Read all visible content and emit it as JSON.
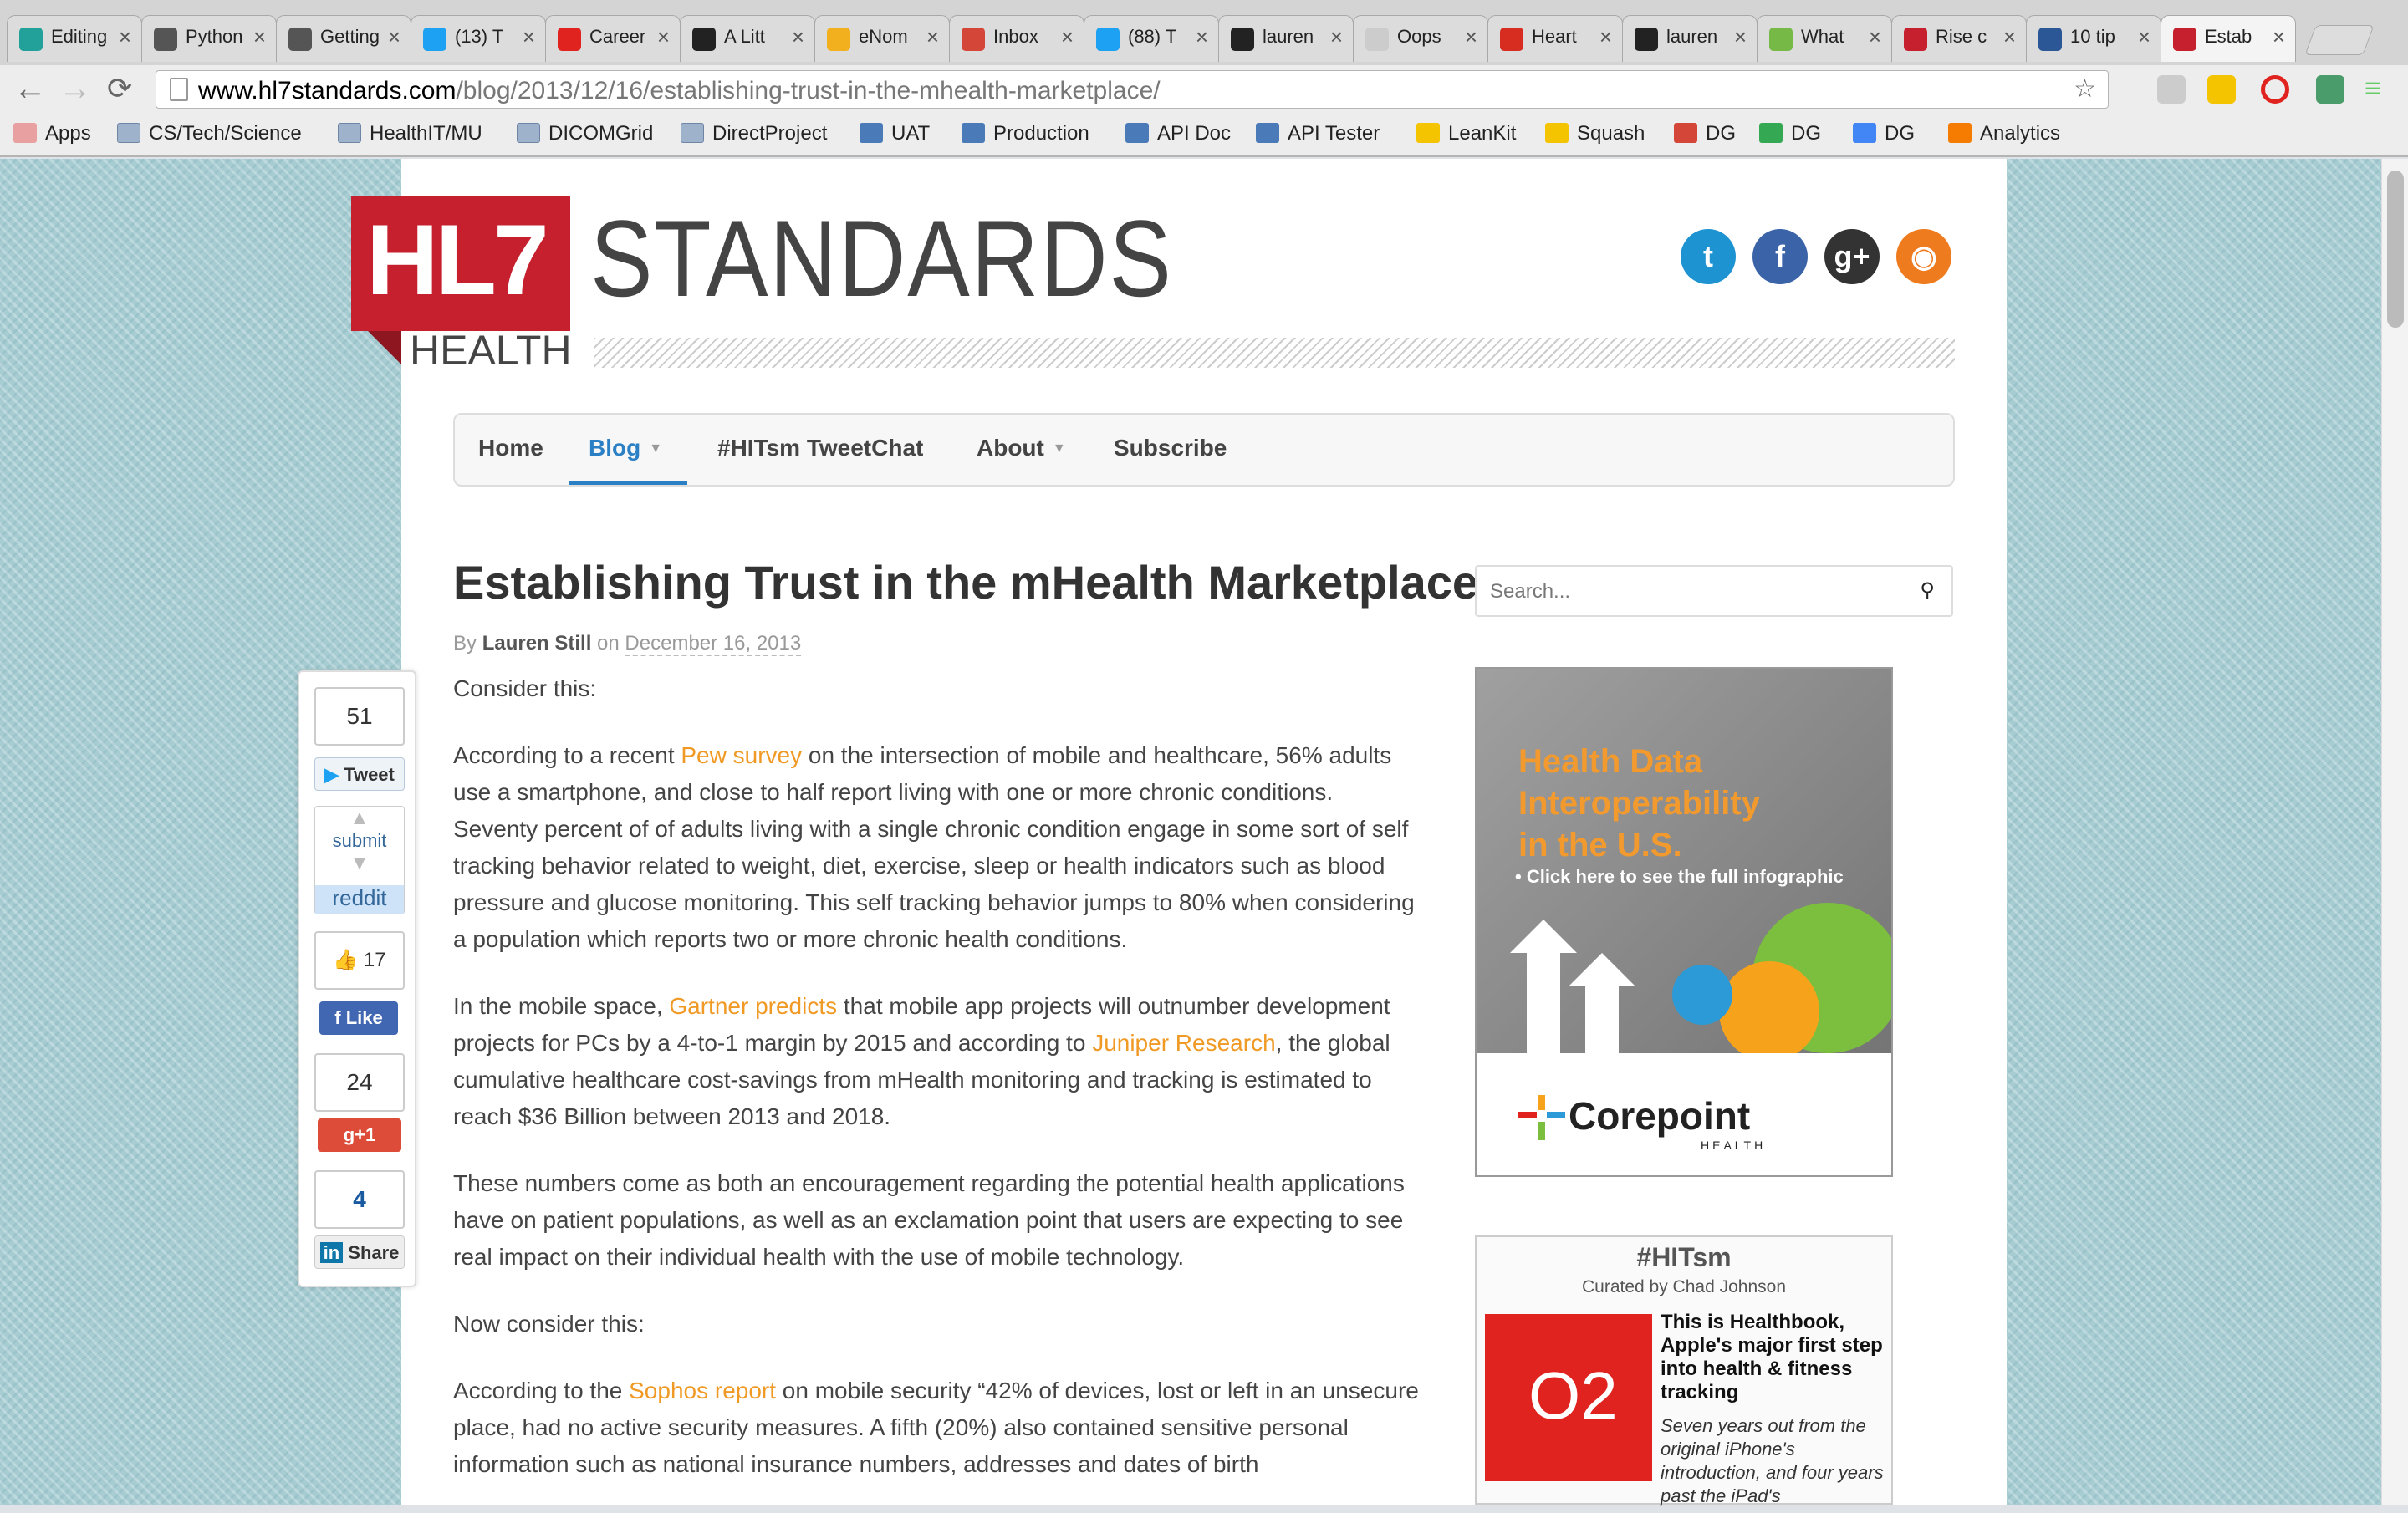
{
  "browser": {
    "tabs": [
      {
        "label": "Editing",
        "icon_color": "#21a19a"
      },
      {
        "label": "Python",
        "icon_color": "#555555"
      },
      {
        "label": "Getting",
        "icon_color": "#555555"
      },
      {
        "label": "(13) T",
        "icon_color": "#1da1f2"
      },
      {
        "label": "Career",
        "icon_color": "#e0231f"
      },
      {
        "label": "A Litt",
        "icon_color": "#222222"
      },
      {
        "label": "eNom",
        "icon_color": "#f2b01e"
      },
      {
        "label": "Inbox",
        "icon_color": "#d44638"
      },
      {
        "label": "(88) T",
        "icon_color": "#1da1f2"
      },
      {
        "label": "lauren",
        "icon_color": "#222222"
      },
      {
        "label": "Oops",
        "icon_color": "#cccccc"
      },
      {
        "label": "Heart",
        "icon_color": "#d62d20"
      },
      {
        "label": "lauren",
        "icon_color": "#222222"
      },
      {
        "label": "What",
        "icon_color": "#76b947"
      },
      {
        "label": "Rise c",
        "icon_color": "#c6202f"
      },
      {
        "label": "10 tip",
        "icon_color": "#2b5797"
      },
      {
        "label": "Estab",
        "icon_color": "#c6202f"
      }
    ],
    "tab_close": "×",
    "url_host": "www.hl7standards.com",
    "url_path": "/blog/2013/12/16/establishing-trust-in-the-mhealth-marketplace/",
    "back": "←",
    "forward": "→",
    "reload": "⟳",
    "star": "☆",
    "bookmarks": [
      {
        "label": "Apps",
        "type": "apps"
      },
      {
        "label": "CS/Tech/Science",
        "type": "folder"
      },
      {
        "label": "HealthIT/MU",
        "type": "folder"
      },
      {
        "label": "DICOMGrid",
        "type": "folder"
      },
      {
        "label": "DirectProject",
        "type": "folder"
      },
      {
        "label": "UAT",
        "type": "page"
      },
      {
        "label": "Production",
        "type": "page"
      },
      {
        "label": "API Doc",
        "type": "page"
      },
      {
        "label": "API Tester",
        "type": "page"
      },
      {
        "label": "LeanKit",
        "type": "site"
      },
      {
        "label": "Squash",
        "type": "site"
      },
      {
        "label": "DG",
        "type": "gmail"
      },
      {
        "label": "DG",
        "type": "drive"
      },
      {
        "label": "DG",
        "type": "calendar"
      },
      {
        "label": "Analytics",
        "type": "analytics"
      }
    ]
  },
  "site": {
    "logo_hl7": "HL7",
    "logo_standards": "STANDARDS",
    "logo_health": "HEALTH",
    "social": [
      {
        "name": "twitter",
        "glyph": "t",
        "color": "#1e93d2"
      },
      {
        "name": "facebook",
        "glyph": "f",
        "color": "#3a63a8"
      },
      {
        "name": "google-plus",
        "glyph": "g+",
        "color": "#333333"
      },
      {
        "name": "rss",
        "glyph": "◉",
        "color": "#ef7b1f"
      }
    ],
    "nav": [
      {
        "label": "Home",
        "active": false,
        "caret": false
      },
      {
        "label": "Blog",
        "active": true,
        "caret": true
      },
      {
        "label": "#HITsm TweetChat",
        "active": false,
        "caret": false
      },
      {
        "label": "About",
        "active": false,
        "caret": true
      },
      {
        "label": "Subscribe",
        "active": false,
        "caret": false
      }
    ]
  },
  "article": {
    "title": "Establishing Trust in the mHealth Marketplace",
    "by": "By",
    "author": "Lauren Still",
    "on": "on",
    "date": "December 16, 2013",
    "p1": "Consider this:",
    "p2_a": "According to a recent ",
    "p2_link": "Pew survey",
    "p2_b": " on the intersection of mobile and healthcare, 56% adults use a smartphone, and close to half report living with one or more chronic conditions. Seventy percent of of adults living with a single chronic condition engage in some sort of self tracking behavior related to weight, diet, exercise, sleep or health indicators such as blood pressure and glucose monitoring. This self tracking behavior jumps to 80% when considering a population which reports two or more chronic health conditions.",
    "p3_a": "In the mobile space, ",
    "p3_link1": "Gartner predicts",
    "p3_b": " that mobile app projects will outnumber development projects for PCs by a 4-to-1 margin by 2015 and according to ",
    "p3_link2": "Juniper Research",
    "p3_c": ", the global cumulative healthcare cost-savings from mHealth monitoring and tracking is estimated to reach $36 Billion between 2013 and 2018.",
    "p4": "These numbers come as both an encouragement regarding the potential health applications have on patient populations, as well as an exclamation point that users are expecting to see real impact on their individual health with the use of mobile technology.",
    "p5": "Now consider this:",
    "p6_a": "According to the ",
    "p6_link": "Sophos report",
    "p6_b": " on mobile security “42% of devices, lost or left in an unsecure place, had no active security measures. A fifth (20%) also contained sensitive personal information such as national insurance numbers, addresses and dates of birth"
  },
  "share": {
    "tweet_count": "51",
    "tweet_label": "Tweet",
    "reddit_submit": "submit",
    "reddit_label": "reddit",
    "like_count": "17",
    "like_label": "Like",
    "gplus_count": "24",
    "gplus_label": "g+1",
    "linkedin_count": "4",
    "linkedin_label": "Share"
  },
  "sidebar": {
    "search_placeholder": "Search...",
    "ad_line1": "Health Data",
    "ad_line2": "Interoperability",
    "ad_line3": "in the U.S.",
    "ad_cta": "• Click here to see the full infographic",
    "ad_brand": "Corepoint",
    "ad_brand_sub": "HEALTH",
    "hitsm_title": "#HITsm",
    "hitsm_curated": "Curated by Chad Johnson",
    "hitsm_img_text": "O2",
    "hitsm_headline": "This is Healthbook, Apple's major first step into health & fitness tracking",
    "hitsm_desc": "Seven years out from the original iPhone's introduction, and four years past the iPad's"
  }
}
